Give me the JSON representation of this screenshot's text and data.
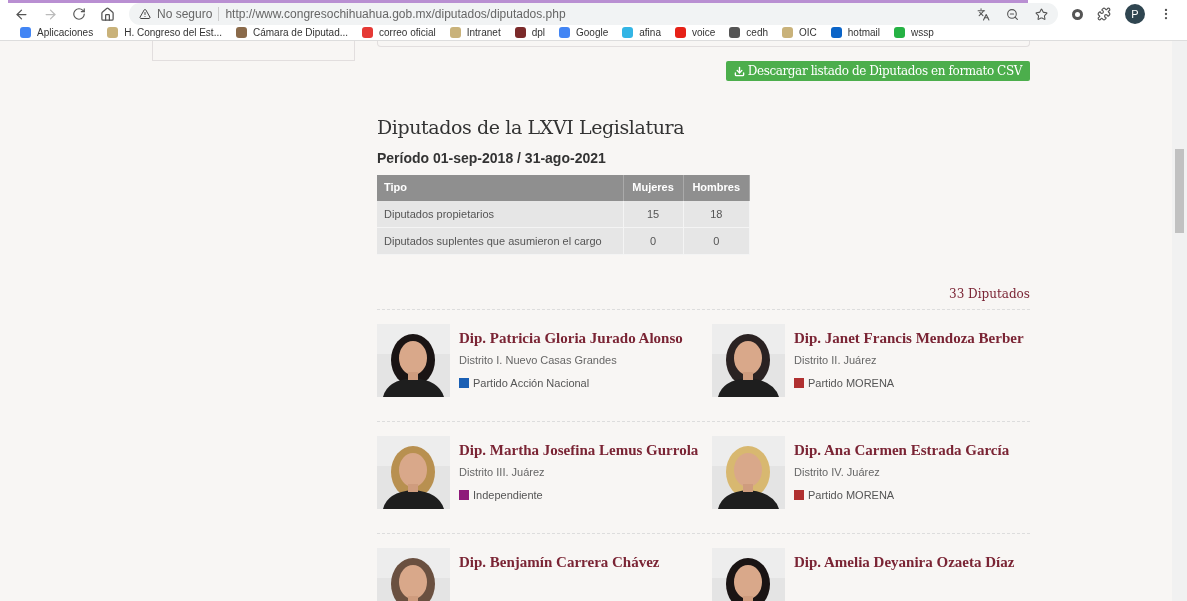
{
  "browser": {
    "security_label": "No seguro",
    "url": "http://www.congresochihuahua.gob.mx/diputados/diputados.php",
    "profile_initial": "P",
    "bookmarks": [
      {
        "label": "Aplicaciones",
        "color": "#4285f4"
      },
      {
        "label": "H. Congreso del Est...",
        "color": "#c9b27a"
      },
      {
        "label": "Cámara de Diputad...",
        "color": "#8a6a4a"
      },
      {
        "label": "correo oficial",
        "color": "#e53935"
      },
      {
        "label": "Intranet",
        "color": "#c9b27a"
      },
      {
        "label": "dpl",
        "color": "#7b2a2a"
      },
      {
        "label": "Google",
        "color": "#4285f4"
      },
      {
        "label": "afina",
        "color": "#33b5e5"
      },
      {
        "label": "voice",
        "color": "#e62117"
      },
      {
        "label": "cedh",
        "color": "#555555"
      },
      {
        "label": "OIC",
        "color": "#c9b27a"
      },
      {
        "label": "hotmail",
        "color": "#0a64c8"
      },
      {
        "label": "wssp",
        "color": "#25b244"
      }
    ]
  },
  "download_button": "Descargar listado de Diputados en formato CSV",
  "title": "Diputados de la LXVI Legislatura",
  "period": "Período 01-sep-2018 / 31-ago-2021",
  "table": {
    "columns": [
      "Tipo",
      "Mujeres",
      "Hombres"
    ],
    "rows": [
      [
        "Diputados propietarios",
        "15",
        "18"
      ],
      [
        "Diputados suplentes que asumieron el cargo",
        "0",
        "0"
      ]
    ]
  },
  "count": "33 Diputados",
  "deputies": [
    {
      "name": "Dip. Patricia Gloria Jurado Alonso",
      "district": "Distrito I. Nuevo Casas Grandes",
      "party": "Partido Acción Nacional",
      "color": "#1a5fb4"
    },
    {
      "name": "Dip. Janet Francis Mendoza Berber",
      "district": "Distrito II. Juárez",
      "party": "Partido MORENA",
      "color": "#b03030"
    },
    {
      "name": "Dip. Martha Josefina Lemus Gurrola",
      "district": "Distrito III. Juárez",
      "party": "Independiente",
      "color": "#8e1a7a"
    },
    {
      "name": "Dip. Ana Carmen Estrada García",
      "district": "Distrito IV. Juárez",
      "party": "Partido MORENA",
      "color": "#b03030"
    },
    {
      "name": "Dip. Benjamín Carrera Chávez"
    },
    {
      "name": "Dip. Amelia Deyanira Ozaeta Díaz"
    }
  ]
}
